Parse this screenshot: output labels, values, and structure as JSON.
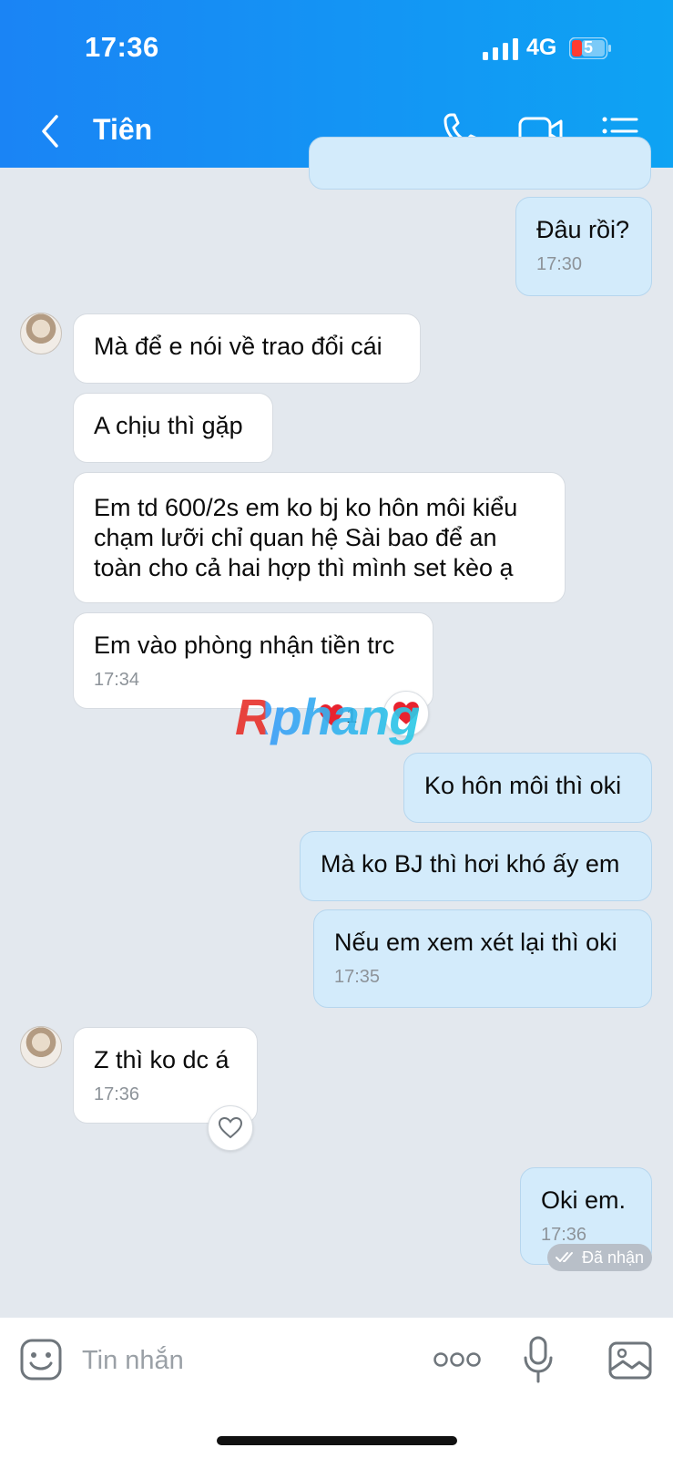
{
  "status_bar": {
    "time": "17:36",
    "network": "4G",
    "battery": "5"
  },
  "header": {
    "contact_name": "Tiên"
  },
  "messages": [
    {
      "text": "Đâu rồi?",
      "time": "17:30"
    },
    {
      "text": "Mà để e nói về trao đổi cái"
    },
    {
      "text": "A chịu thì gặp"
    },
    {
      "text": "Em td 600/2s em ko bj ko hôn môi kiểu chạm lưỡi chỉ quan hệ Sài bao để an toàn cho cả hai hợp thì mình set kèo ạ"
    },
    {
      "text": "Em vào phòng nhận tiền trc",
      "time": "17:34",
      "reaction_count": "1"
    },
    {
      "text": "Ko hôn môi thì oki"
    },
    {
      "text": "Mà ko BJ thì hơi khó ấy em"
    },
    {
      "text": "Nếu em xem xét lại thì oki",
      "time": "17:35"
    },
    {
      "text": "Z thì ko dc á",
      "time": "17:36"
    },
    {
      "text": "Oki em.",
      "time": "17:36"
    }
  ],
  "watermark": "Rphang",
  "received_status": "Đã nhận",
  "input": {
    "placeholder": "Tin nhắn"
  },
  "colors": {
    "header_gradient_start": "#1a84f5",
    "header_gradient_end": "#0ea3f3",
    "outgoing_bubble": "#d3ebfb",
    "incoming_bubble": "#ffffff",
    "background": "#e3e8ee"
  }
}
